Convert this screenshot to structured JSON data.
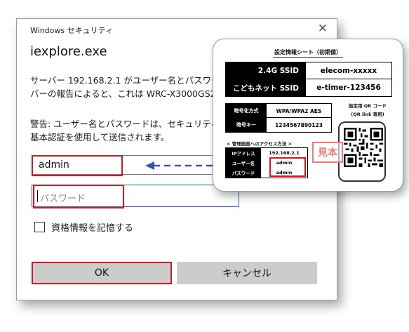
{
  "dialog": {
    "window_title": "Windows セキュリティ",
    "app_title": "iexplore.exe",
    "message": "サーバー 192.168.2.1 がユーザー名とパスワードを要求しています。サー\nバーの報告によると、これは WRC-X3000GS2 からの要求です。",
    "warning": "警告: ユーザー名とパスワードは、セキュリティで保護されていない接続で\n基本認証を使用して送信されます。",
    "username_value": "admin",
    "password_placeholder": "パスワード",
    "remember_label": "資格情報を記憶する",
    "ok_label": "OK",
    "cancel_label": "キャンセル",
    "close_glyph": "×"
  },
  "card": {
    "title": "設定情報シート（初期値）",
    "ssid_rows": [
      {
        "label": "2.4G SSID",
        "value": "elecom-xxxxx"
      },
      {
        "label": "こどもネット SSID",
        "value": "e-timer-123456"
      }
    ],
    "enc_rows": [
      {
        "label": "暗号化方式",
        "value": "WPA/WPA2 AES"
      },
      {
        "label": "暗号キー",
        "value": "1234567890123"
      }
    ],
    "qr_label_line1": "設定用 QR コード",
    "qr_label_line2": "(QR link 専用)",
    "access_title": "< 管理画面へのアクセス方法 >",
    "access_rows": [
      {
        "label": "IPアドレス",
        "value": "192.168.2.1"
      },
      {
        "label": "ユーザー名",
        "value": "admin"
      },
      {
        "label": "パスワード",
        "value": "admin"
      }
    ],
    "sample_stamp": "見本"
  },
  "colors": {
    "highlight": "#e0141e",
    "arrow": "#3a56a8",
    "button_bg": "#cccccc"
  }
}
